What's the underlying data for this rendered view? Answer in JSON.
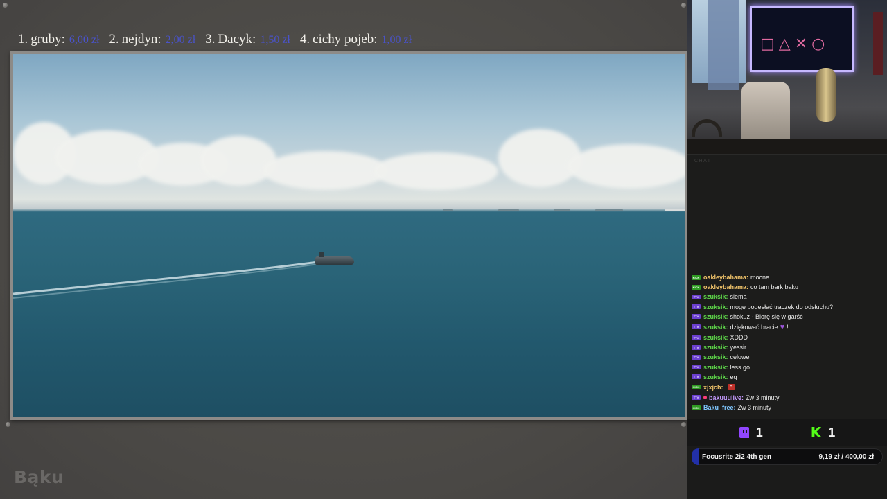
{
  "leaderboard": [
    {
      "rank": "1.",
      "name": "gruby:",
      "amount": "6,00 zł"
    },
    {
      "rank": "2.",
      "name": "nejdyn:",
      "amount": "2,00 zł"
    },
    {
      "rank": "3.",
      "name": "Dacyk:",
      "amount": "1,50 zł"
    },
    {
      "rank": "4.",
      "name": "cichy pojeb:",
      "amount": "1,00 zł"
    }
  ],
  "channel_name": "Bąku",
  "chat": {
    "title": "CHAT",
    "messages": [
      {
        "platform": "kick",
        "badge": "KICK",
        "user": "oakleybahama:",
        "user_color": "#f0c36a",
        "text": "mocne"
      },
      {
        "platform": "kick",
        "badge": "KICK",
        "user": "oakleybahama:",
        "user_color": "#f0c36a",
        "text": "co tam bark baku"
      },
      {
        "platform": "twitch",
        "badge": "TTV",
        "user": "szuksik:",
        "user_color": "#5fd84a",
        "text": "siema"
      },
      {
        "platform": "twitch",
        "badge": "TTV",
        "user": "szuksik:",
        "user_color": "#5fd84a",
        "text": "mogę podesłać traczek do odsłuchu?"
      },
      {
        "platform": "twitch",
        "badge": "TTV",
        "user": "szuksik:",
        "user_color": "#5fd84a",
        "text": "shokuz - Biorę się w garść"
      },
      {
        "platform": "twitch",
        "badge": "TTV",
        "user": "szuksik:",
        "user_color": "#5fd84a",
        "text": "dziękować bracie",
        "suffix": "!"
      },
      {
        "platform": "twitch",
        "badge": "TTV",
        "user": "szuksik:",
        "user_color": "#5fd84a",
        "text": "XDDD"
      },
      {
        "platform": "twitch",
        "badge": "TTV",
        "user": "szuksik:",
        "user_color": "#5fd84a",
        "text": "yessir"
      },
      {
        "platform": "twitch",
        "badge": "TTV",
        "user": "szuksik:",
        "user_color": "#5fd84a",
        "text": "celowe"
      },
      {
        "platform": "twitch",
        "badge": "TTV",
        "user": "szuksik:",
        "user_color": "#5fd84a",
        "text": "less go"
      },
      {
        "platform": "twitch",
        "badge": "TTV",
        "user": "szuksik:",
        "user_color": "#5fd84a",
        "text": "eq"
      },
      {
        "platform": "kick",
        "badge": "KICK",
        "user": "xjxjch:",
        "user_color": "#f0c36a",
        "text": ""
      },
      {
        "platform": "twitch",
        "badge": "TTV",
        "user": "bakuuulive:",
        "user_color": "#c69bff",
        "text": "Zw 3 minuty"
      },
      {
        "platform": "kick",
        "badge": "KICK",
        "user": "Baku_free:",
        "user_color": "#7fc7ff",
        "text": "Zw 3 minuty"
      }
    ]
  },
  "viewers": {
    "twitch": "1",
    "kick": "1"
  },
  "donation_goal": {
    "name": "Focusrite 2i2 4th gen",
    "current": "9,19 zł",
    "separator": "/",
    "target": "400,00 zł"
  },
  "colors": {
    "leaderboard_amount": "#4a53c9",
    "twitch": "#9146ff",
    "kick": "#53fc18",
    "goal_fill": "#2230a8"
  }
}
